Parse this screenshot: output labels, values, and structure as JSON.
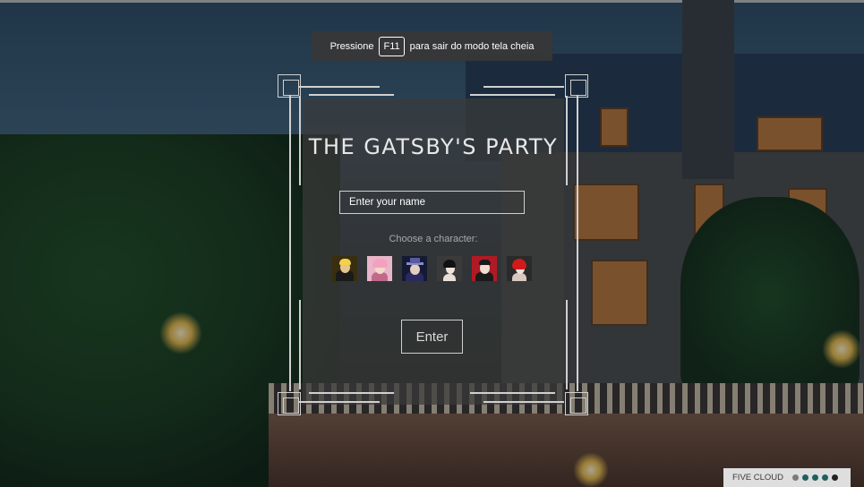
{
  "fullscreen_notice": {
    "prefix": "Pressione",
    "key": "F11",
    "suffix": "para sair do modo tela cheia"
  },
  "game": {
    "title": "THE GATSBY'S PARTY",
    "name_placeholder": "Enter your name",
    "choose_label": "Choose a character:",
    "enter_label": "Enter"
  },
  "characters": [
    {
      "name": "blonde-man-character",
      "icon": "character-avatar"
    },
    {
      "name": "pink-hair-woman-character",
      "icon": "character-avatar"
    },
    {
      "name": "hat-man-character",
      "icon": "character-avatar"
    },
    {
      "name": "dark-hair-woman-character",
      "icon": "character-avatar"
    },
    {
      "name": "red-background-man-character",
      "icon": "character-avatar"
    },
    {
      "name": "red-hair-woman-character",
      "icon": "character-avatar"
    }
  ],
  "footer": {
    "brand": "FIVE CLOUD",
    "dot_colors": [
      "#7a7a7a",
      "#1f5f5f",
      "#1f5f5f",
      "#1f5f5f",
      "#222222"
    ]
  },
  "colors": {
    "panel": "#3a3a3a",
    "frame": "#d0d0d0",
    "title": "#e8e8e8"
  }
}
